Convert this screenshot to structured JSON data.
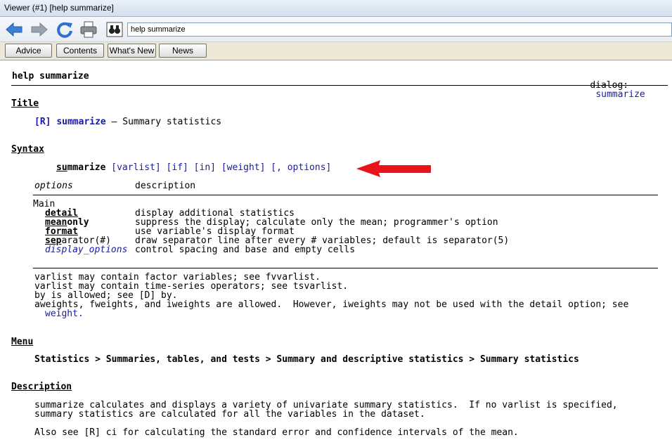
{
  "window": {
    "title": "Viewer (#1) [help summarize]"
  },
  "toolbar": {
    "address": "help summarize",
    "icons": [
      "back-arrow-icon",
      "forward-arrow-icon",
      "refresh-icon",
      "print-icon",
      "search-binoculars-icon"
    ]
  },
  "nav": {
    "advice": "Advice",
    "contents": "Contents",
    "whats_new": "What's New",
    "news": "News"
  },
  "help": {
    "header": {
      "left": "help summarize",
      "dialog_label": "dialog:",
      "dialog_link": "summarize"
    },
    "title_heading": "Title",
    "title_line": {
      "ref": "[R]",
      "cmd": "summarize",
      "dash": " — ",
      "desc": "Summary statistics"
    },
    "syntax_heading": "Syntax",
    "syntax": {
      "cmd_u": "su",
      "cmd_rest": "mmarize",
      "args": " [varlist] [if] [in] [weight] [, options]"
    },
    "options_table": {
      "col1": "options",
      "col2": "description",
      "group": "Main",
      "rows": [
        {
          "u": "detail",
          "rest": "",
          "desc": "display additional statistics"
        },
        {
          "u": "mean",
          "rest": "only",
          "desc": "suppress the display; calculate only the mean; programmer's option"
        },
        {
          "u": "format",
          "rest": "",
          "desc": "use variable's display format"
        },
        {
          "u": "sep",
          "rest": "arator(#)",
          "desc": "draw separator line after every # variables; default is separator(5)"
        },
        {
          "u": "",
          "rest": "display_options",
          "desc": "control spacing and base and empty cells"
        }
      ]
    },
    "notes": [
      "varlist may contain factor variables; see fvvarlist.",
      "varlist may contain time-series operators; see tsvarlist.",
      "by is allowed; see [D] by.",
      "aweights, fweights, and iweights are allowed.  However, iweights may not be used with the detail option; see",
      "weight."
    ],
    "menu_heading": "Menu",
    "menu_path": "Statistics > Summaries, tables, and tests > Summary and descriptive statistics > Summary statistics",
    "description_heading": "Description",
    "desc_lines": [
      "summarize calculates and displays a variety of univariate summary statistics.  If no varlist is specified,",
      "summary statistics are calculated for all the variables in the dataset."
    ],
    "also_see": "Also see [R] ci for calculating the standard error and confidence intervals of the mean."
  },
  "annotation": {
    "arrow_color": "#e8141b"
  }
}
